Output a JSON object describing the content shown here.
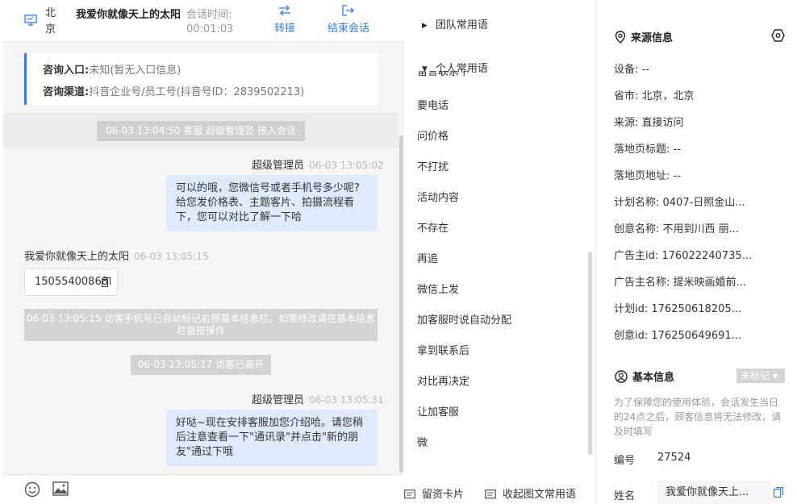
{
  "header": {
    "city": "北京",
    "visitor_name": "我爱你就像天上的太阳",
    "time_label": "会话时间:",
    "time_value": "00:01:03",
    "transfer_label": "转接",
    "end_label": "结束会话"
  },
  "info_card": {
    "entry_label": "咨询入口:",
    "entry_value": "未知(暂无入口信息)",
    "channel_label": "咨询渠道:",
    "channel_value": "抖音企业号/员工号(抖音号ID：2839502213)"
  },
  "messages": {
    "sys1": "06-03 13:04:50 客服 超级管理员 接入会话",
    "agent1_name": "超级管理员",
    "agent1_time": "06-03 13:05:02",
    "agent1_text": "可以的哦，您微信号或者手机号多少呢?给您发价格表、主题客片、拍摄流程看下，您可以对比了解一下哈",
    "visitor_name": "我爱你就像天上的太阳",
    "visitor_time": "06-03 13:05:15",
    "visitor_phone": "15055400868",
    "sys2": "06-03 13:05:15 访客手机号已自动标记右侧基本信息栏，如需修改请在基本信息栏直接操作",
    "sys3": "06-03 13:05:17 访客已离开",
    "agent2_name": "超级管理员",
    "agent2_time": "06-03 13:05:31",
    "agent2_text": "好哒~现在安排客服加您介绍哈。请您稍后注意查看一下\"通讯录\"并点击\"新的朋友\"通过下哦"
  },
  "phrases": {
    "team_group": "团队常用语",
    "personal_group": "个人常用语",
    "cut_item": "留言联系下",
    "items": [
      "要电话",
      "问价格",
      "不打扰",
      "活动内容",
      "不存在",
      "再追",
      "微信上发",
      "加客服时说自动分配",
      "拿到联系后",
      "对比再决定",
      "让加客服",
      "微"
    ],
    "card_btn": "留资卡片",
    "collect_btn": "收起图文常用语"
  },
  "source": {
    "title": "来源信息",
    "rows": [
      "设备: --",
      "省市: 北京，北京",
      "来源: 直接访问",
      "落地页标题: --",
      "落地页地址: --",
      "计划名称: 0407-日照金山...",
      "创意名称: 不用到川西 丽...",
      "广告主id: 176022240735...",
      "广告主名称: 提米映画婚前...",
      "计划id: 176250618205...",
      "创意id: 176250649691..."
    ]
  },
  "basic": {
    "title": "基本信息",
    "tag": "未标记",
    "notice": "为了保障您的使用体验，会话发生当日的24点之后，顾客信息将无法修改，请及时填写",
    "id_label": "编号",
    "id_value": "27524",
    "name_label": "姓名",
    "name_value": "我爱你就像天上..."
  },
  "colors": {
    "accent": "#2f7cf6",
    "bubble": "#dfeafb",
    "system_msg": "#d3d3d3"
  }
}
